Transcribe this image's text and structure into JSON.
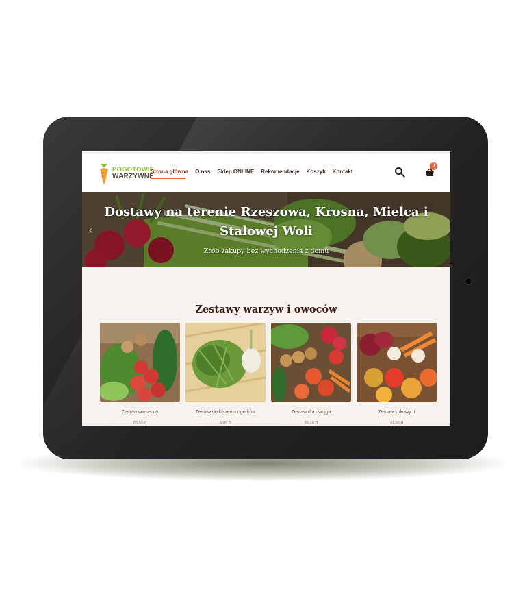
{
  "brand": {
    "logo_line1": "POGOTOWIE",
    "logo_line2": "WARZYWNE",
    "accent_color": "#e8623a",
    "green_color": "#8dbb3a"
  },
  "nav": {
    "items": [
      {
        "label": "Strona główna",
        "active": true
      },
      {
        "label": "O nas"
      },
      {
        "label": "Sklep ONLINE"
      },
      {
        "label": "Rekomendacje"
      },
      {
        "label": "Koszyk"
      },
      {
        "label": "Kontakt"
      }
    ],
    "search_icon": "search-icon",
    "cart_icon": "basket-icon",
    "cart_count": "0"
  },
  "hero": {
    "title": "Dostawy na terenie Rzeszowa, Krosna, Mielca i Stalowej Woli",
    "subtitle": "Zrób zakupy bez wychodzenia z domu",
    "prev_arrow": "‹"
  },
  "products_section": {
    "title": "Zestawy warzyw i owoców",
    "items": [
      {
        "name": "Zestaw wiosenny",
        "price": "86,50 zł"
      },
      {
        "name": "Zestaw do kiszenia ogórków",
        "price": "5,00 zł"
      },
      {
        "name": "Zestaw dla dwojga",
        "price": "82,10 zł"
      },
      {
        "name": "Zestaw sokowy II",
        "price": "41,00 zł"
      }
    ]
  }
}
